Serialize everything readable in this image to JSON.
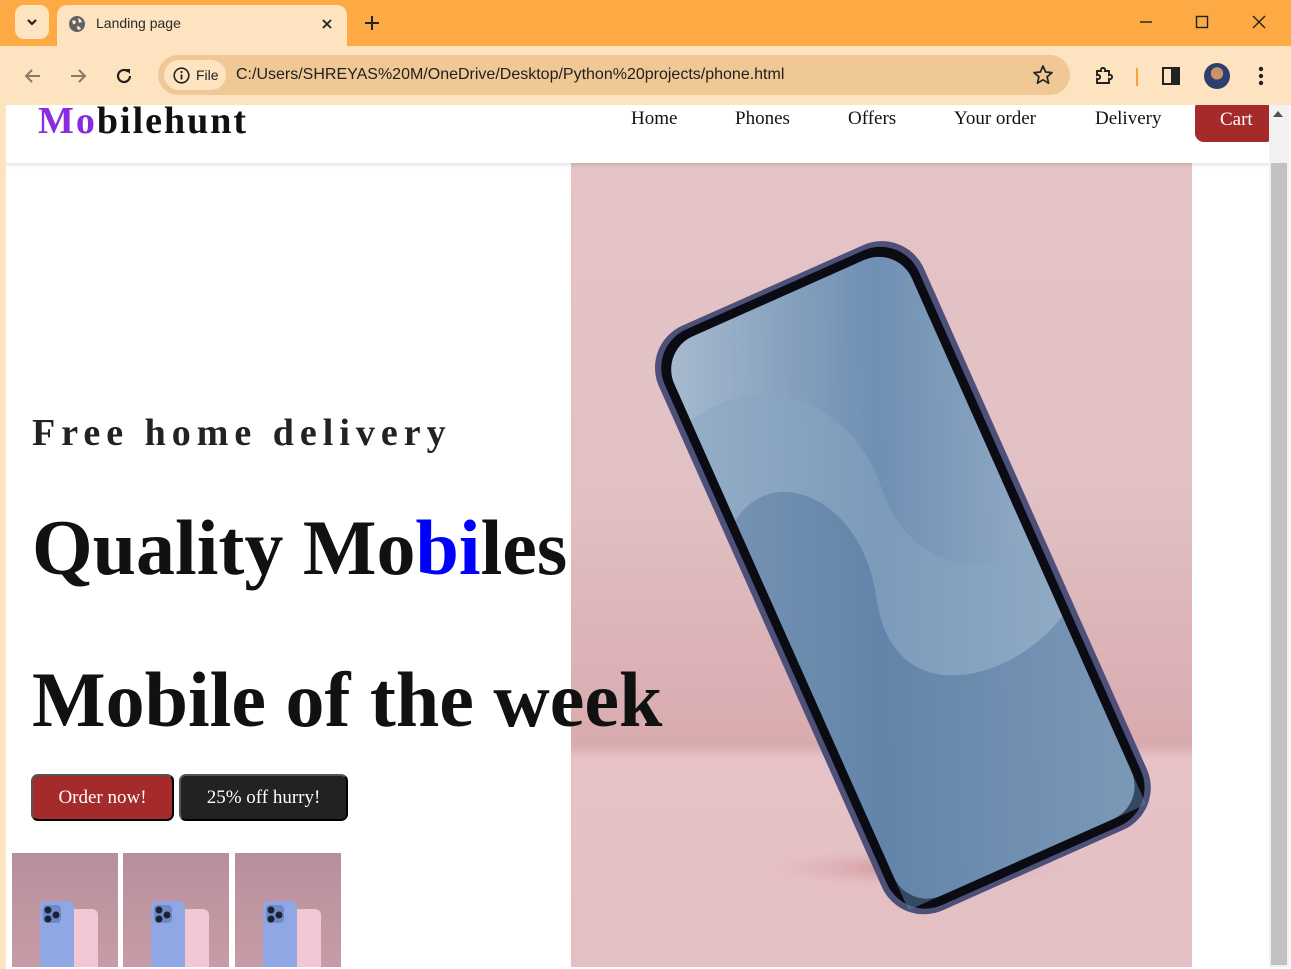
{
  "browser": {
    "tab_title": "Landing page",
    "address_chip": "File",
    "url": "C:/Users/SHREYAS%20M/OneDrive/Desktop/Python%20projects/phone.html",
    "accent": "#fdaa44",
    "toolbar_color": "#fde3c0"
  },
  "site": {
    "logo_prefix": "Mo",
    "logo_rest": "bilehunt",
    "nav": [
      "Home",
      "Phones",
      "Offers",
      "Your order",
      "Delivery"
    ],
    "cart": "Cart",
    "brand_color": "#a52a2a"
  },
  "hero": {
    "tagline": "Free home delivery",
    "headline_a": "Quality Mo",
    "headline_b": "bi",
    "headline_c": "les",
    "subhead": "Mobile of the week",
    "order_button": "Order now!",
    "offer_button": "25% off hurry!"
  }
}
